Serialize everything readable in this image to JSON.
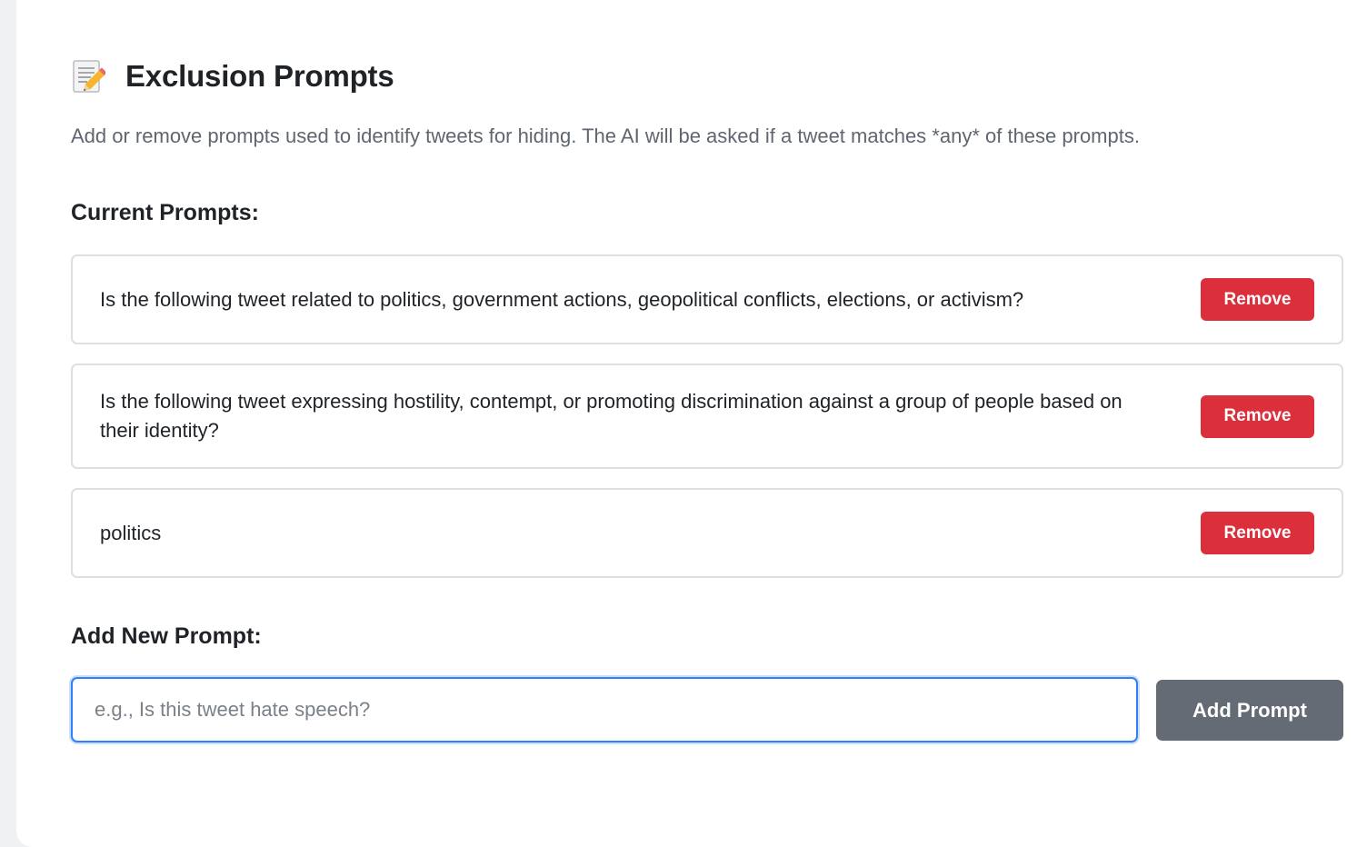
{
  "header": {
    "icon": "memo-icon",
    "title": "Exclusion Prompts",
    "description": "Add or remove prompts used to identify tweets for hiding. The AI will be asked if a tweet matches *any* of these prompts."
  },
  "current": {
    "heading": "Current Prompts:",
    "prompts": [
      {
        "text": "Is the following tweet related to politics, government actions, geopolitical conflicts, elections, or activism?",
        "remove_label": "Remove"
      },
      {
        "text": "Is the following tweet expressing hostility, contempt, or promoting discrimination against a group of people based on their identity?",
        "remove_label": "Remove"
      },
      {
        "text": "politics",
        "remove_label": "Remove"
      }
    ]
  },
  "add": {
    "heading": "Add New Prompt:",
    "input_value": "",
    "input_placeholder": "e.g., Is this tweet hate speech?",
    "button_label": "Add Prompt"
  },
  "colors": {
    "remove_button": "#dc2f3c",
    "add_button": "#646b74",
    "input_focus_border": "#2f81f7"
  }
}
